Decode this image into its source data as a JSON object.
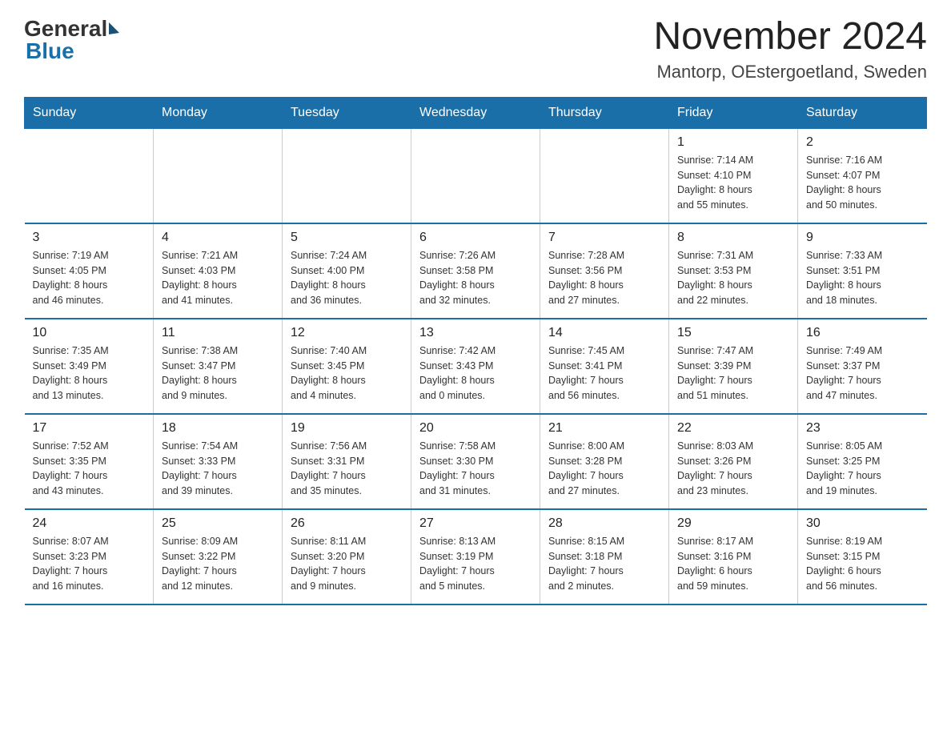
{
  "header": {
    "logo_general": "General",
    "logo_blue": "Blue",
    "title": "November 2024",
    "subtitle": "Mantorp, OEstergoetland, Sweden"
  },
  "days_of_week": [
    "Sunday",
    "Monday",
    "Tuesday",
    "Wednesday",
    "Thursday",
    "Friday",
    "Saturday"
  ],
  "weeks": [
    {
      "cells": [
        {
          "day": "",
          "info": ""
        },
        {
          "day": "",
          "info": ""
        },
        {
          "day": "",
          "info": ""
        },
        {
          "day": "",
          "info": ""
        },
        {
          "day": "",
          "info": ""
        },
        {
          "day": "1",
          "info": "Sunrise: 7:14 AM\nSunset: 4:10 PM\nDaylight: 8 hours\nand 55 minutes."
        },
        {
          "day": "2",
          "info": "Sunrise: 7:16 AM\nSunset: 4:07 PM\nDaylight: 8 hours\nand 50 minutes."
        }
      ]
    },
    {
      "cells": [
        {
          "day": "3",
          "info": "Sunrise: 7:19 AM\nSunset: 4:05 PM\nDaylight: 8 hours\nand 46 minutes."
        },
        {
          "day": "4",
          "info": "Sunrise: 7:21 AM\nSunset: 4:03 PM\nDaylight: 8 hours\nand 41 minutes."
        },
        {
          "day": "5",
          "info": "Sunrise: 7:24 AM\nSunset: 4:00 PM\nDaylight: 8 hours\nand 36 minutes."
        },
        {
          "day": "6",
          "info": "Sunrise: 7:26 AM\nSunset: 3:58 PM\nDaylight: 8 hours\nand 32 minutes."
        },
        {
          "day": "7",
          "info": "Sunrise: 7:28 AM\nSunset: 3:56 PM\nDaylight: 8 hours\nand 27 minutes."
        },
        {
          "day": "8",
          "info": "Sunrise: 7:31 AM\nSunset: 3:53 PM\nDaylight: 8 hours\nand 22 minutes."
        },
        {
          "day": "9",
          "info": "Sunrise: 7:33 AM\nSunset: 3:51 PM\nDaylight: 8 hours\nand 18 minutes."
        }
      ]
    },
    {
      "cells": [
        {
          "day": "10",
          "info": "Sunrise: 7:35 AM\nSunset: 3:49 PM\nDaylight: 8 hours\nand 13 minutes."
        },
        {
          "day": "11",
          "info": "Sunrise: 7:38 AM\nSunset: 3:47 PM\nDaylight: 8 hours\nand 9 minutes."
        },
        {
          "day": "12",
          "info": "Sunrise: 7:40 AM\nSunset: 3:45 PM\nDaylight: 8 hours\nand 4 minutes."
        },
        {
          "day": "13",
          "info": "Sunrise: 7:42 AM\nSunset: 3:43 PM\nDaylight: 8 hours\nand 0 minutes."
        },
        {
          "day": "14",
          "info": "Sunrise: 7:45 AM\nSunset: 3:41 PM\nDaylight: 7 hours\nand 56 minutes."
        },
        {
          "day": "15",
          "info": "Sunrise: 7:47 AM\nSunset: 3:39 PM\nDaylight: 7 hours\nand 51 minutes."
        },
        {
          "day": "16",
          "info": "Sunrise: 7:49 AM\nSunset: 3:37 PM\nDaylight: 7 hours\nand 47 minutes."
        }
      ]
    },
    {
      "cells": [
        {
          "day": "17",
          "info": "Sunrise: 7:52 AM\nSunset: 3:35 PM\nDaylight: 7 hours\nand 43 minutes."
        },
        {
          "day": "18",
          "info": "Sunrise: 7:54 AM\nSunset: 3:33 PM\nDaylight: 7 hours\nand 39 minutes."
        },
        {
          "day": "19",
          "info": "Sunrise: 7:56 AM\nSunset: 3:31 PM\nDaylight: 7 hours\nand 35 minutes."
        },
        {
          "day": "20",
          "info": "Sunrise: 7:58 AM\nSunset: 3:30 PM\nDaylight: 7 hours\nand 31 minutes."
        },
        {
          "day": "21",
          "info": "Sunrise: 8:00 AM\nSunset: 3:28 PM\nDaylight: 7 hours\nand 27 minutes."
        },
        {
          "day": "22",
          "info": "Sunrise: 8:03 AM\nSunset: 3:26 PM\nDaylight: 7 hours\nand 23 minutes."
        },
        {
          "day": "23",
          "info": "Sunrise: 8:05 AM\nSunset: 3:25 PM\nDaylight: 7 hours\nand 19 minutes."
        }
      ]
    },
    {
      "cells": [
        {
          "day": "24",
          "info": "Sunrise: 8:07 AM\nSunset: 3:23 PM\nDaylight: 7 hours\nand 16 minutes."
        },
        {
          "day": "25",
          "info": "Sunrise: 8:09 AM\nSunset: 3:22 PM\nDaylight: 7 hours\nand 12 minutes."
        },
        {
          "day": "26",
          "info": "Sunrise: 8:11 AM\nSunset: 3:20 PM\nDaylight: 7 hours\nand 9 minutes."
        },
        {
          "day": "27",
          "info": "Sunrise: 8:13 AM\nSunset: 3:19 PM\nDaylight: 7 hours\nand 5 minutes."
        },
        {
          "day": "28",
          "info": "Sunrise: 8:15 AM\nSunset: 3:18 PM\nDaylight: 7 hours\nand 2 minutes."
        },
        {
          "day": "29",
          "info": "Sunrise: 8:17 AM\nSunset: 3:16 PM\nDaylight: 6 hours\nand 59 minutes."
        },
        {
          "day": "30",
          "info": "Sunrise: 8:19 AM\nSunset: 3:15 PM\nDaylight: 6 hours\nand 56 minutes."
        }
      ]
    }
  ]
}
